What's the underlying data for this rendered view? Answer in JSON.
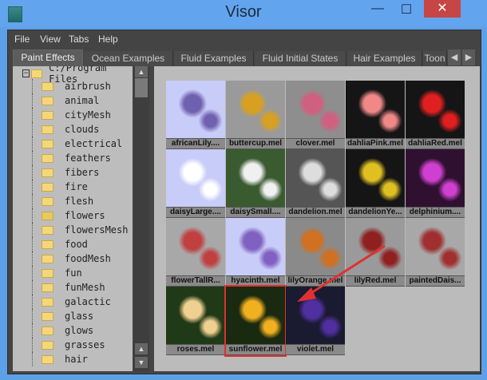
{
  "window": {
    "title": "Visor",
    "minimize": "—",
    "maximize": "☐",
    "close": "✕"
  },
  "menu": [
    "File",
    "View",
    "Tabs",
    "Help"
  ],
  "tabs": [
    "Paint Effects",
    "Ocean Examples",
    "Fluid Examples",
    "Fluid Initial States",
    "Hair Examples",
    "Toon"
  ],
  "tree": {
    "root": "C:/Program Files",
    "items": [
      "airbrush",
      "animal",
      "cityMesh",
      "clouds",
      "electrical",
      "feathers",
      "fibers",
      "fire",
      "flesh",
      "flowers",
      "flowersMesh",
      "food",
      "foodMesh",
      "fun",
      "funMesh",
      "galactic",
      "glass",
      "glows",
      "grasses",
      "hair"
    ],
    "open": "flowers"
  },
  "thumbnails": [
    {
      "label": "africanLily....",
      "bg": "#c8ccf8",
      "fg": "#7060b0"
    },
    {
      "label": "buttercup.mel",
      "bg": "#9a9a9a",
      "fg": "#d8a020"
    },
    {
      "label": "clover.mel",
      "bg": "#8e8e8e",
      "fg": "#d06080"
    },
    {
      "label": "dahliaPink.mel",
      "bg": "#151515",
      "fg": "#f08888"
    },
    {
      "label": "dahliaRed.mel",
      "bg": "#151515",
      "fg": "#e02020"
    },
    {
      "label": "daisyLarge....",
      "bg": "#c8ccf8",
      "fg": "#ffffff"
    },
    {
      "label": "daisySmall....",
      "bg": "#3a5a30",
      "fg": "#f0f0f0"
    },
    {
      "label": "dandelion.mel",
      "bg": "#555555",
      "fg": "#dddddd"
    },
    {
      "label": "dandelionYe...",
      "bg": "#151515",
      "fg": "#e0c020"
    },
    {
      "label": "delphinium....",
      "bg": "#301030",
      "fg": "#d040d0"
    },
    {
      "label": "flowerTallR...",
      "bg": "#a8a8a8",
      "fg": "#c04040"
    },
    {
      "label": "hyacinth.mel",
      "bg": "#c8ccf8",
      "fg": "#8060c0"
    },
    {
      "label": "lilyOrange.mel",
      "bg": "#8a8a8a",
      "fg": "#d07020"
    },
    {
      "label": "lilyRed.mel",
      "bg": "#9a9a9a",
      "fg": "#902020"
    },
    {
      "label": "paintedDais...",
      "bg": "#a8a8a8",
      "fg": "#a03030"
    },
    {
      "label": "roses.mel",
      "bg": "#203a18",
      "fg": "#f0d090"
    },
    {
      "label": "sunflower.mel",
      "bg": "#1a2a10",
      "fg": "#f0b020",
      "selected": true
    },
    {
      "label": "violet.mel",
      "bg": "#1a1a30",
      "fg": "#5030a0"
    }
  ],
  "annotation_color": "#e03030"
}
